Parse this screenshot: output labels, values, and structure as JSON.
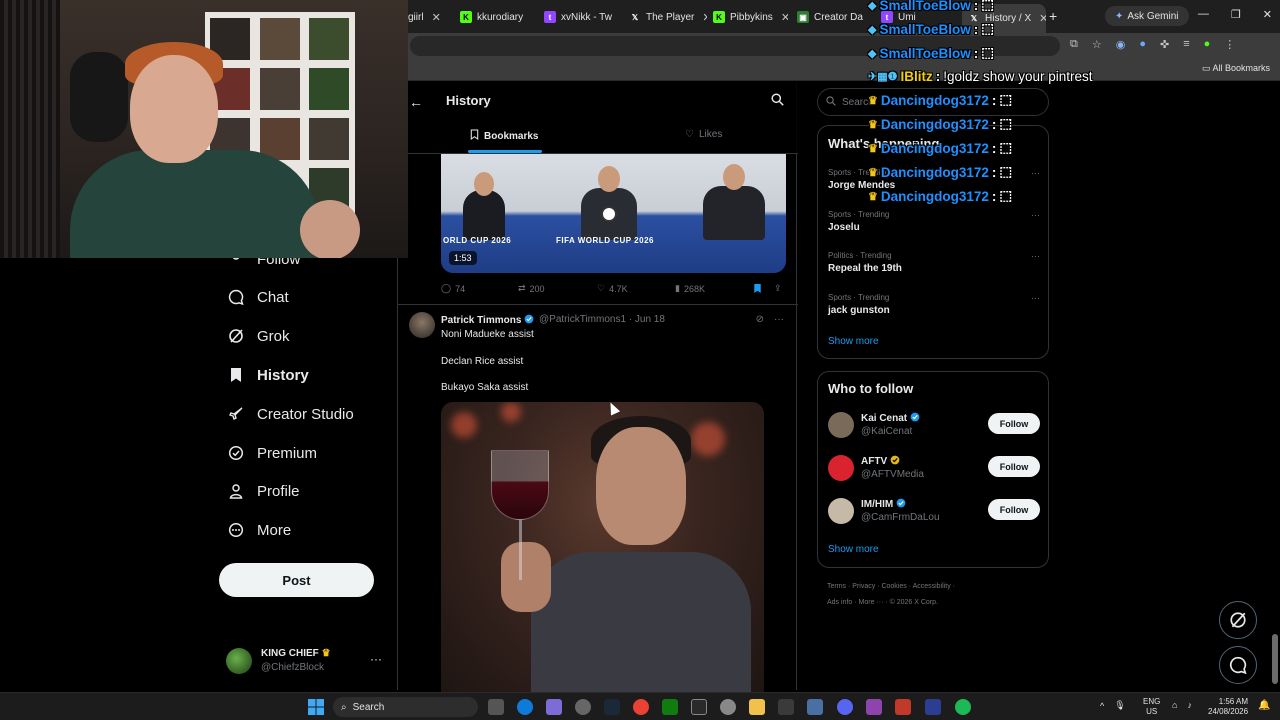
{
  "browser": {
    "tabs": [
      {
        "label": "giirl",
        "icon": "tab-favicon"
      },
      {
        "label": "kkurodiary",
        "icon": "kick-icon"
      },
      {
        "label": "xvNikk - Tw",
        "icon": "twitch-icon"
      },
      {
        "label": "The Player",
        "icon": "x-icon"
      },
      {
        "label": "Pibbykins",
        "icon": "kick-icon"
      },
      {
        "label": "Creator Da",
        "icon": "creator-icon"
      },
      {
        "label": "Umi",
        "icon": "twitch-icon"
      },
      {
        "label": "History / X",
        "icon": "x-icon"
      }
    ],
    "ask_gemini": "Ask Gemini",
    "all_bookmarks": "All Bookmarks"
  },
  "nav": {
    "items": [
      {
        "label": "Follow",
        "icon": "follow-icon"
      },
      {
        "label": "Chat",
        "icon": "chat-icon"
      },
      {
        "label": "Grok",
        "icon": "grok-icon"
      },
      {
        "label": "History",
        "icon": "bookmark-icon"
      },
      {
        "label": "Creator Studio",
        "icon": "rocket-icon"
      },
      {
        "label": "Premium",
        "icon": "premium-icon"
      },
      {
        "label": "Profile",
        "icon": "profile-icon"
      },
      {
        "label": "More",
        "icon": "more-icon"
      }
    ],
    "post_label": "Post",
    "account": {
      "name": "KING CHIEF",
      "handle": "@ChiefzBlock"
    }
  },
  "history": {
    "title": "History",
    "tabs": {
      "bookmarks": "Bookmarks",
      "likes": "Likes"
    },
    "tweet1": {
      "banner_left": "ORLD CUP 2026",
      "banner_mid": "FIFA WORLD CUP 2026",
      "duration": "1:53",
      "replies": "74",
      "reposts": "200",
      "likes": "4.7K",
      "views": "268K"
    },
    "tweet2": {
      "name": "Patrick Timmons",
      "handle": "@PatrickTimmons1 · Jun 18",
      "lines": [
        "Noni Madueke assist",
        "Declan Rice assist",
        "Bukayo Saka assist"
      ]
    }
  },
  "sidebar": {
    "search_placeholder": "Search",
    "trending_title": "What's happening",
    "trends": [
      {
        "meta": "Sports · Trending",
        "name": "Jorge Mendes"
      },
      {
        "meta": "Sports · Trending",
        "name": "Joselu"
      },
      {
        "meta": "Politics · Trending",
        "name": "Repeal the 19th"
      },
      {
        "meta": "Sports · Trending",
        "name": "jack gunston"
      }
    ],
    "show_more": "Show more",
    "wtf_title": "Who to follow",
    "wtf": [
      {
        "name": "Kai Cenat",
        "handle": "@KaiCenat",
        "avatar_color": "#7a6a5a",
        "badge": "blue"
      },
      {
        "name": "AFTV",
        "handle": "@AFTVMedia",
        "avatar_color": "#d9232e",
        "badge": "gold"
      },
      {
        "name": "IM/HIM",
        "handle": "@CamFrmDaLou",
        "avatar_color": "#c7b9a8",
        "badge": "blue"
      }
    ],
    "follow_label": "Follow",
    "footer_row1": "Terms · Privacy · Cookies · Accessibility ·",
    "footer_row2": "Ads info · More ··· · © 2026 X Corp."
  },
  "chat_overlay": [
    {
      "user": "SmallToeBlow",
      "msg": ""
    },
    {
      "user": "SmallToeBlow",
      "msg": ""
    },
    {
      "user": "SmallToeBlow",
      "msg": ""
    },
    {
      "user": "IBlitz",
      "msg": "!goldz show your pintrest"
    },
    {
      "user": "Dancingdog3172",
      "msg": ""
    },
    {
      "user": "Dancingdog3172",
      "msg": ""
    },
    {
      "user": "Dancingdog3172",
      "msg": ""
    },
    {
      "user": "Dancingdog3172",
      "msg": ""
    },
    {
      "user": "Dancingdog3172",
      "msg": ""
    }
  ],
  "taskbar": {
    "search": "Search",
    "lang_top": "ENG",
    "lang_bottom": "US",
    "time": "1:56 AM",
    "date": "24/08/2026"
  },
  "colors": {
    "accent": "#1d9bf0",
    "background": "#000000",
    "border": "#2f3336",
    "muted": "#71767b"
  }
}
